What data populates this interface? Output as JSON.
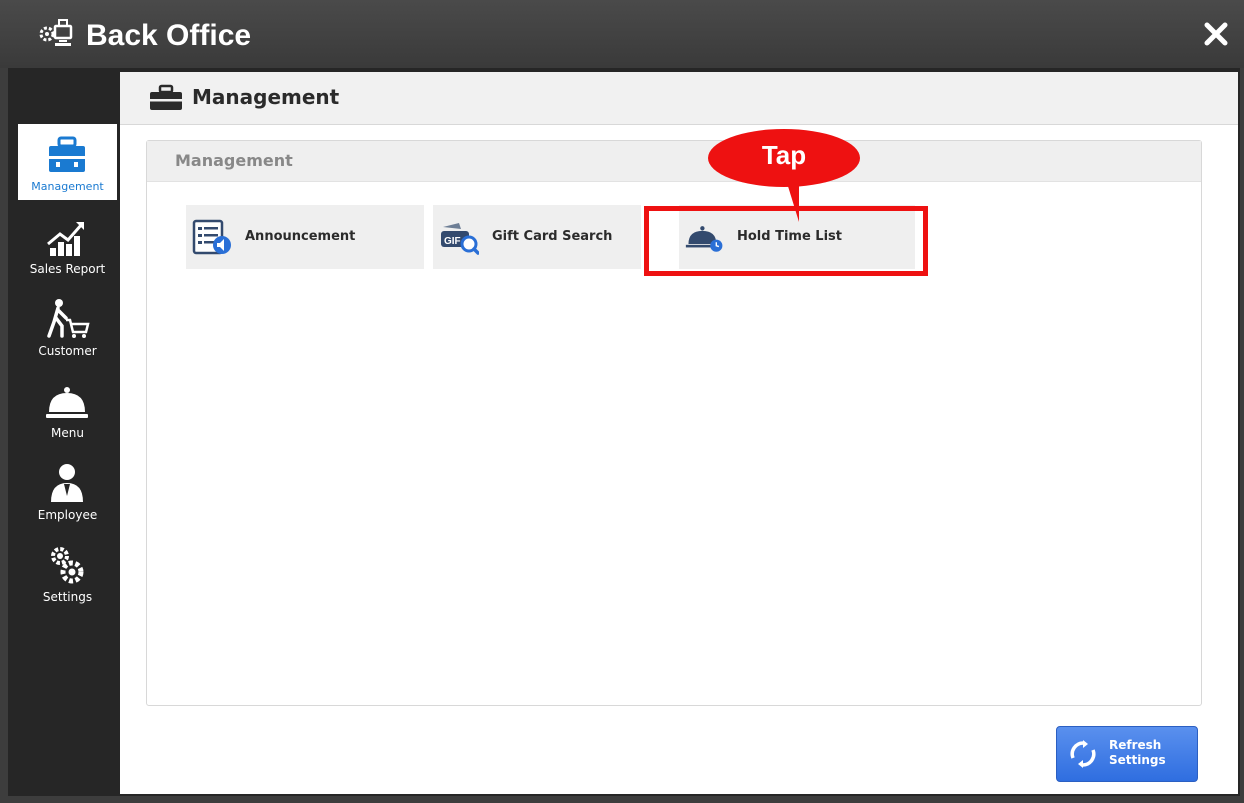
{
  "window": {
    "title": "Back Office",
    "logo_icon": "gear-monitor-icon",
    "close_icon": "close-icon"
  },
  "sidebar": {
    "items": [
      {
        "label": "Management",
        "icon": "briefcase-icon",
        "active": true
      },
      {
        "label": "Sales Report",
        "icon": "growth-chart-icon",
        "active": false
      },
      {
        "label": "Customer",
        "icon": "shopper-cart-icon",
        "active": false
      },
      {
        "label": "Menu",
        "icon": "cloche-icon",
        "active": false
      },
      {
        "label": "Employee",
        "icon": "employee-icon",
        "active": false
      },
      {
        "label": "Settings",
        "icon": "gears-icon",
        "active": false
      }
    ]
  },
  "header": {
    "title": "Management",
    "icon": "briefcase-icon"
  },
  "panel": {
    "title": "Management",
    "tiles": [
      {
        "label": "Announcement",
        "icon": "announcement-icon"
      },
      {
        "label": "Gift Card Search",
        "icon": "gift-card-search-icon"
      },
      {
        "label": "Hold Time List",
        "icon": "cloche-clock-icon"
      }
    ]
  },
  "annotation": {
    "callout_text": "Tap"
  },
  "footer": {
    "refresh_line1": "Refresh",
    "refresh_line2": "Settings",
    "icon": "refresh-icon"
  },
  "colors": {
    "accent_blue": "#1a7ad1",
    "button_blue": "#3a78e6",
    "highlight_red": "#ee1111",
    "sidebar_bg": "#262626"
  }
}
